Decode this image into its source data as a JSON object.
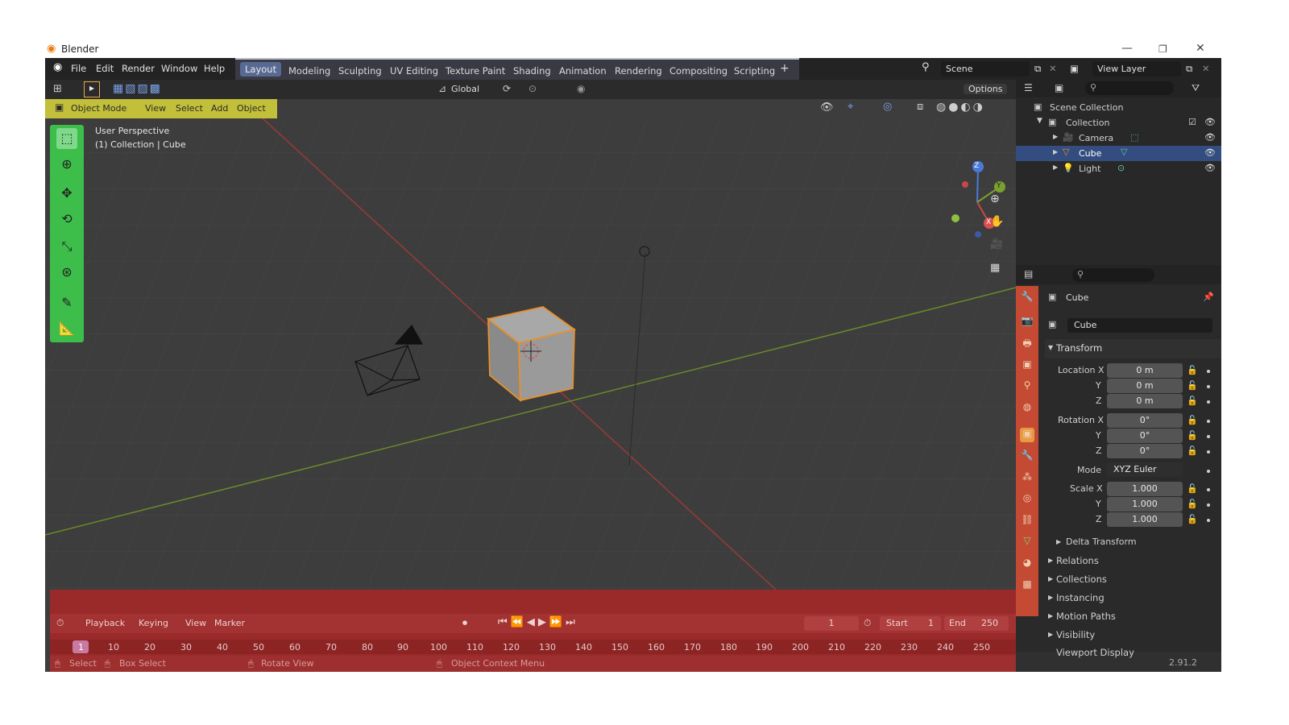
{
  "window": {
    "title": "Blender",
    "minimize": "—",
    "maximize": "❐",
    "close": "✕"
  },
  "menu": [
    "File",
    "Edit",
    "Render",
    "Window",
    "Help"
  ],
  "workspaces": {
    "tabs": [
      "Layout",
      "Modeling",
      "Sculpting",
      "UV Editing",
      "Texture Paint",
      "Shading",
      "Animation",
      "Rendering",
      "Compositing",
      "Scripting"
    ],
    "add": "+"
  },
  "scene": {
    "label": "Scene",
    "view_layer": "View Layer"
  },
  "viewport_header": {
    "transform": "Global",
    "options": "Options"
  },
  "mode_bar": {
    "mode": "Object Mode",
    "items": [
      "View",
      "Select",
      "Add",
      "Object"
    ]
  },
  "viewport_info": {
    "perspective": "User Perspective",
    "collection": "(1) Collection | Cube"
  },
  "gizmo": {
    "x": "X",
    "y": "Y",
    "z": "Z"
  },
  "outliner": {
    "root": "Scene Collection",
    "collection": "Collection",
    "items": [
      "Camera",
      "Cube",
      "Light"
    ]
  },
  "properties": {
    "object_name": "Cube",
    "data_name": "Cube",
    "section_transform": "Transform",
    "location_label": "Location X",
    "rotation_label": "Rotation X",
    "scale_label": "Scale X",
    "y_label": "Y",
    "z_label": "Z",
    "location": [
      "0 m",
      "0 m",
      "0 m"
    ],
    "rotation": [
      "0°",
      "0°",
      "0°"
    ],
    "mode_label": "Mode",
    "mode_value": "XYZ Euler",
    "scale": [
      "1.000",
      "1.000",
      "1.000"
    ],
    "delta": "Delta Transform",
    "sections": [
      "Relations",
      "Collections",
      "Instancing",
      "Motion Paths",
      "Visibility",
      "Viewport Display"
    ]
  },
  "timeline": {
    "menus": [
      "Playback",
      "Keying",
      "View",
      "Marker"
    ],
    "current_frame": "1",
    "start_label": "Start",
    "start": "1",
    "end_label": "End",
    "end": "250",
    "ticks": [
      "1",
      "10",
      "20",
      "30",
      "40",
      "50",
      "60",
      "70",
      "80",
      "90",
      "100",
      "110",
      "120",
      "130",
      "140",
      "150",
      "160",
      "170",
      "180",
      "190",
      "200",
      "210",
      "220",
      "230",
      "240",
      "250"
    ]
  },
  "status": {
    "select": "Select",
    "box_select": "Box Select",
    "rotate_view": "Rotate View",
    "context_menu": "Object Context Menu",
    "version": "2.91.2"
  }
}
